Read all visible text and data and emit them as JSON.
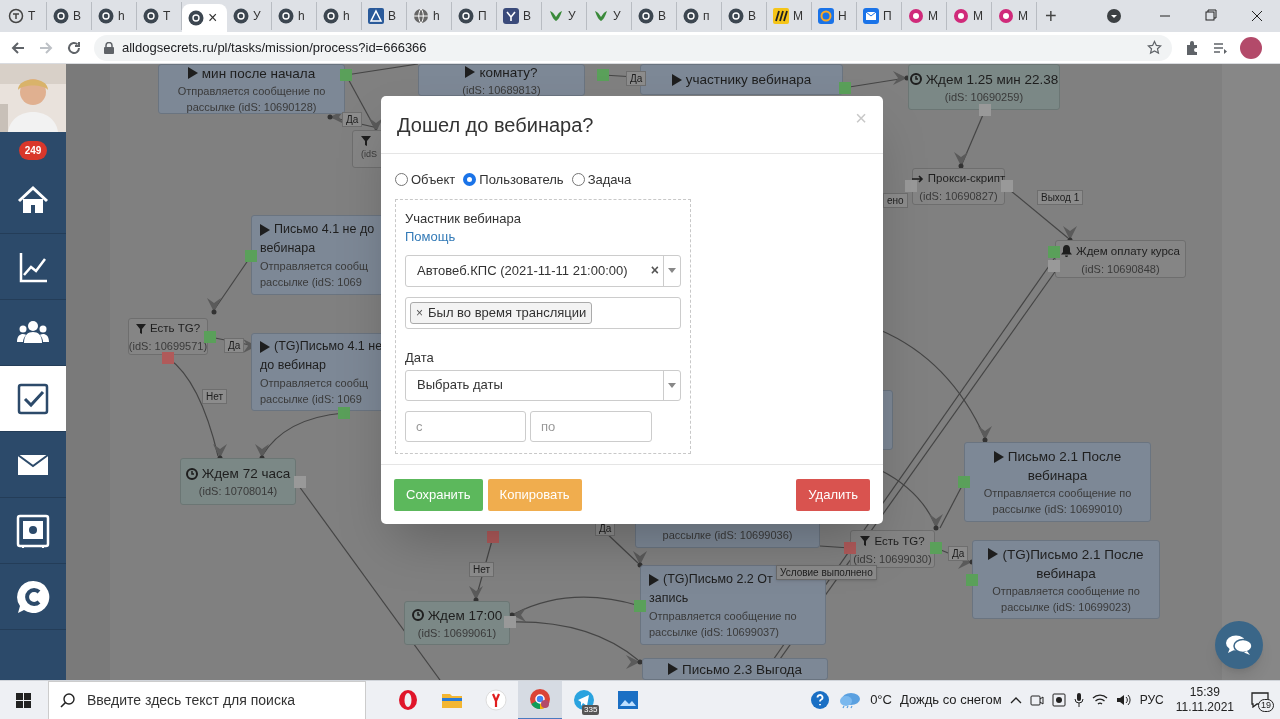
{
  "browser": {
    "tabs": [
      {
        "kind": "t",
        "label": "Т",
        "selected": false
      },
      {
        "kind": "gc",
        "label": "В",
        "selected": false
      },
      {
        "kind": "gc",
        "label": "h",
        "selected": false
      },
      {
        "kind": "gc",
        "label": "Т",
        "selected": false
      },
      {
        "kind": "gc",
        "close": "×",
        "selected": true
      },
      {
        "kind": "gc",
        "label": "У",
        "selected": false
      },
      {
        "kind": "gc",
        "label": "h",
        "selected": false
      },
      {
        "kind": "gc",
        "label": "h",
        "selected": false
      },
      {
        "kind": "tri",
        "label": "В",
        "selected": false
      },
      {
        "kind": "globe",
        "label": "h",
        "selected": false
      },
      {
        "kind": "gc",
        "label": "П",
        "selected": false
      },
      {
        "kind": "y",
        "label": "В",
        "selected": false
      },
      {
        "kind": "bird",
        "label": "У",
        "selected": false
      },
      {
        "kind": "bird",
        "label": "У",
        "selected": false
      },
      {
        "kind": "gc",
        "label": "В",
        "selected": false
      },
      {
        "kind": "gc",
        "label": "п",
        "selected": false
      },
      {
        "kind": "gc",
        "label": "В",
        "selected": false
      },
      {
        "kind": "m",
        "label": "М",
        "selected": false
      },
      {
        "kind": "at",
        "label": "Н",
        "selected": false
      },
      {
        "kind": "mail",
        "label": "П",
        "selected": false
      },
      {
        "kind": "g",
        "label": "М",
        "selected": false
      },
      {
        "kind": "g",
        "label": "М",
        "selected": false
      },
      {
        "kind": "g",
        "label": "М",
        "selected": false
      }
    ],
    "new_tab": "+",
    "url": "alldogsecrets.ru/pl/tasks/mission/process?id=666366"
  },
  "sidebar": {
    "badge": "249",
    "items": [
      {
        "kind": "home",
        "selected": false
      },
      {
        "kind": "chart",
        "selected": false
      },
      {
        "kind": "users",
        "selected": false
      },
      {
        "kind": "tasks",
        "selected": true
      },
      {
        "kind": "mail",
        "selected": false
      },
      {
        "kind": "safe",
        "selected": false
      },
      {
        "kind": "logo",
        "selected": false
      }
    ]
  },
  "canvas": {
    "nodes": [
      {
        "kind": "message",
        "title_lines": [
          "мин после начала"
        ],
        "detail_lines": [
          "Отправляется сообщение по",
          "рассылке (idS: 10690128)"
        ]
      },
      {
        "kind": "message",
        "title_lines": [
          "комнату?"
        ],
        "detail_lines": [
          "(idS: 10689813)"
        ]
      },
      {
        "kind": "message",
        "title_lines": [
          "участнику вебинара"
        ]
      },
      {
        "kind": "wait",
        "title_lines": [
          "Ждем 1.25 мин 22.38"
        ],
        "detail_lines": [
          "(idS: 10690259)"
        ]
      },
      {
        "kind": "filter",
        "detail_lines": [
          "(idS"
        ]
      },
      {
        "kind": "proxy",
        "title_lines": [
          "Прокси-скрипт"
        ],
        "detail_lines": [
          "(idS: 10690827)"
        ]
      },
      {
        "kind": "bell",
        "title_lines": [
          "Ждем оплату курса"
        ],
        "detail_lines": [
          "(idS: 10690848)"
        ]
      },
      {
        "kind": "filter",
        "title_lines": [
          "Есть TG?"
        ],
        "detail_lines": [
          "(idS: 10699571)"
        ]
      },
      {
        "kind": "message",
        "title_lines": [
          "Письмо 4.1 не до",
          "вебинара"
        ],
        "detail_lines": [
          "Отправляется сообщ",
          "рассылке (idS: 1069"
        ]
      },
      {
        "kind": "message",
        "title_lines": [
          "(TG)Письмо 4.1 не",
          "до вебинар"
        ],
        "detail_lines": [
          "Отправляется сообщ",
          "рассылке (idS: 1069"
        ]
      },
      {
        "kind": "wait",
        "title_lines": [
          "Ждем 72 часа"
        ],
        "detail_lines": [
          "(idS: 10708014)"
        ]
      },
      {
        "kind": "wait",
        "title_lines": [
          "Ждем 17:00"
        ],
        "detail_lines": [
          "(idS: 10699061)"
        ]
      },
      {
        "kind": "message",
        "detail_lines": [
          "рассылке (idS: 10699036)"
        ]
      },
      {
        "kind": "message",
        "title_lines": [
          "(TG)Письмо 2.2 От",
          "запись"
        ],
        "detail_lines": [
          "Отправляется сообщение по",
          "рассылке (idS: 10699037)"
        ]
      },
      {
        "kind": "message",
        "title_lines": [
          "Письмо 2.3 Выгода"
        ]
      },
      {
        "kind": "filter",
        "title_lines": [
          "Есть TG?"
        ],
        "detail_lines": [
          "(idS: 10699030)"
        ]
      },
      {
        "kind": "message",
        "title_lines": [
          "Письмо 2.1 После",
          "вебинара"
        ],
        "detail_lines": [
          "Отправляется сообщение по",
          "рассылке (idS: 10699010)"
        ]
      },
      {
        "kind": "message",
        "title_lines": [
          "(TG)Письмо 2.1 После",
          "вебинара"
        ],
        "detail_lines": [
          "Отправляется сообщение по",
          "рассылке (idS: 10699023)"
        ]
      },
      {
        "kind": "message"
      }
    ],
    "labels": [
      {
        "text": "Да"
      },
      {
        "text": "Да"
      },
      {
        "text": "ено"
      },
      {
        "text": "Выход 1"
      },
      {
        "text": "Да"
      },
      {
        "text": "Нет"
      },
      {
        "text": "Нет"
      },
      {
        "text": "Да"
      },
      {
        "text": "Да"
      }
    ],
    "tooltip": {
      "text": "Условие выполнено"
    }
  },
  "modal": {
    "title": "Дошел до вебинара?",
    "close": "×",
    "radios": [
      {
        "label": "Объект",
        "selected": false
      },
      {
        "label": "Пользователь",
        "selected": true
      },
      {
        "label": "Задача",
        "selected": false
      }
    ],
    "field_label": "Участник вебинара",
    "help_link": "Помощь",
    "webinar_select": {
      "value": "Автовеб.КПС (2021-11-11 21:00:00)",
      "clear": "×"
    },
    "tags": [
      {
        "remove": "×",
        "text": "Был во время трансляции"
      }
    ],
    "date_label": "Дата",
    "date_select": {
      "value": "Выбрать даты"
    },
    "from": {
      "placeholder": "с"
    },
    "to": {
      "placeholder": "по"
    },
    "buttons": [
      {
        "kind": "success",
        "label": "Сохранить"
      },
      {
        "kind": "warning",
        "label": "Копировать"
      },
      {
        "kind": "danger",
        "label": "Удалить"
      }
    ]
  },
  "taskbar": {
    "search": {
      "placeholder": "Введите здесь текст для поиска"
    },
    "apps": [
      {
        "kind": "opera",
        "selected": false
      },
      {
        "kind": "explorer",
        "selected": false
      },
      {
        "kind": "yandex",
        "selected": false
      },
      {
        "kind": "chrome",
        "selected": true
      },
      {
        "kind": "telegram",
        "selected": false,
        "badge": "335"
      },
      {
        "kind": "photos",
        "selected": false
      }
    ],
    "temperature": "0°C",
    "weather": "Дождь со снегом",
    "language": "РУС",
    "time": "15:39",
    "date": "11.11.2021",
    "notifications": "19"
  }
}
